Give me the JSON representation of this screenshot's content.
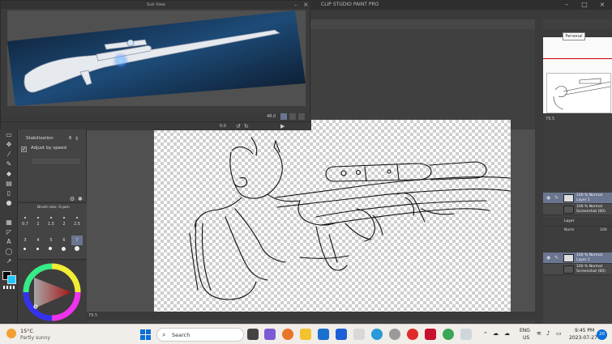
{
  "app": {
    "title": "CLIP STUDIO PAINT PRO",
    "subview_title": "Sub View",
    "tooltip": "Personal"
  },
  "subview": {
    "zoom": "48.0",
    "angle": "0.0"
  },
  "tool_property": {
    "stabilization_label": "Stabilization",
    "stabilization_value": "6",
    "adjust_by_speed_label": "Adjust by speed",
    "adjust_by_speed_checked": true
  },
  "brush_size": {
    "title": "Brush size: G-pen",
    "sizes": [
      "0.7",
      "1",
      "1.5",
      "2",
      "2.5",
      "3",
      "4",
      "5",
      "6",
      "7"
    ],
    "selected": "7"
  },
  "canvas": {
    "zoom": "79.5",
    "nav_zoom": "79.5"
  },
  "layers": {
    "blend_mode": "Norm",
    "opacity": "100",
    "rows": [
      {
        "line1": "100 % Normal",
        "line2": "Layer 1",
        "selected": true
      },
      {
        "line1": "100 % Normal",
        "line2": "Screenshot (60)",
        "selected": false
      },
      {
        "line1": "Layer",
        "line2": "",
        "selected": false
      },
      {
        "line1": "100 % Normal",
        "line2": "Layer 1",
        "selected": true
      },
      {
        "line1": "100 % Normal",
        "line2": "Screenshot (60)",
        "selected": false
      }
    ]
  },
  "taskbar": {
    "weather_temp": "15°C",
    "weather_cond": "Partly sunny",
    "search_placeholder": "Search",
    "lang_line1": "ENG",
    "lang_line2": "US",
    "time": "9:45 PM",
    "date": "2023-07-27",
    "notif_count": "20"
  },
  "colors": {
    "accent_fg": "#000000",
    "accent_bg": "#1ec8ff",
    "selected_layer": "#6a7590"
  }
}
